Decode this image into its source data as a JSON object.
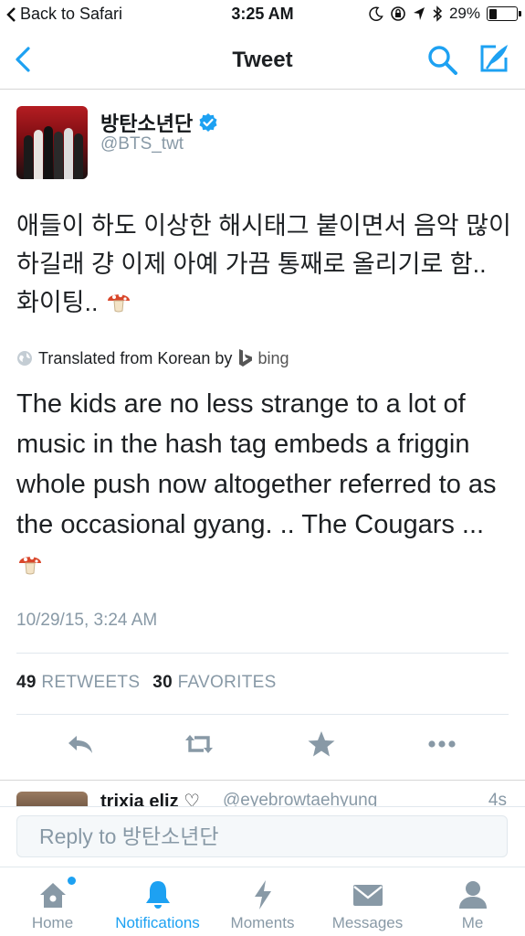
{
  "status_bar": {
    "back_label": "Back to Safari",
    "time": "3:25 AM",
    "battery": "29%",
    "battery_level": 0.29
  },
  "nav": {
    "title": "Tweet",
    "icons": [
      "back-chevron-icon",
      "search-icon",
      "compose-icon"
    ]
  },
  "tweet": {
    "display_name": "방탄소년단",
    "handle": "@BTS_twt",
    "text": "애들이 하도 이상한 해시태그 붙이면서 음악 많이 하길래 걍 이제 아예 가끔 통째로 올리기로 함.. 화이팅..",
    "translated_label": "Translated from Korean by",
    "translator": "bing",
    "translation": "The kids are no less strange to a lot of music in the hash tag embeds a friggin whole push now altogether referred to as the occasional gyang. .. The Cougars ...",
    "timestamp": "10/29/15, 3:24 AM",
    "retweets_count": "49",
    "retweets_label": "RETWEETS",
    "favorites_count": "30",
    "favorites_label": "FAVORITES"
  },
  "reply_preview": {
    "name": "trixia eliz",
    "handle": "@eyebrowtaehyung",
    "time": "4s"
  },
  "reply_bar": {
    "placeholder": "Reply to 방탄소년단"
  },
  "tabs": [
    {
      "label": "Home",
      "icon": "home-icon"
    },
    {
      "label": "Notifications",
      "icon": "bell-icon"
    },
    {
      "label": "Moments",
      "icon": "lightning-icon"
    },
    {
      "label": "Messages",
      "icon": "envelope-icon"
    },
    {
      "label": "Me",
      "icon": "person-icon"
    }
  ],
  "colors": {
    "accent": "#1da1f2",
    "muted": "#8899a6",
    "text": "#1d2023"
  }
}
